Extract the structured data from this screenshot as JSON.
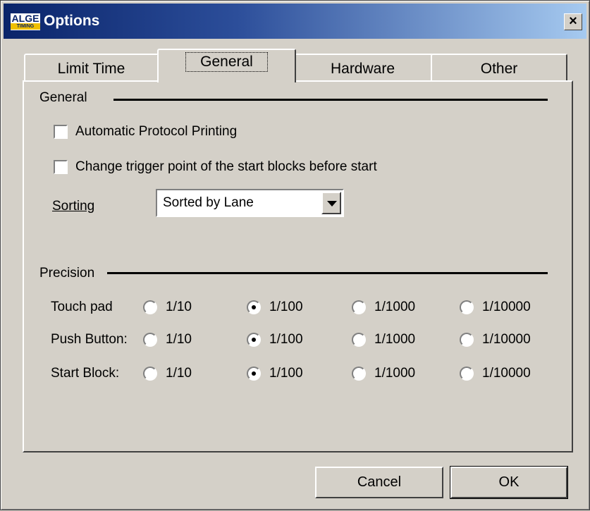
{
  "window": {
    "title": "Options",
    "logo_text": "ALGE",
    "logo_sub": "TIMING",
    "close_label": "×"
  },
  "tabs": [
    {
      "label": "Limit Time",
      "active": false
    },
    {
      "label": "General",
      "active": true
    },
    {
      "label": "Hardware",
      "active": false
    },
    {
      "label": "Other",
      "active": false
    }
  ],
  "general": {
    "section_label": "General",
    "auto_print": {
      "label": "Automatic Protocol Printing",
      "checked": false
    },
    "change_trigger": {
      "label": "Change trigger point of the start blocks before start",
      "checked": false
    },
    "sorting": {
      "label": "Sorting",
      "value": "Sorted by Lane"
    }
  },
  "precision": {
    "section_label": "Precision",
    "options": [
      "1/10",
      "1/100",
      "1/1000",
      "1/10000"
    ],
    "rows": [
      {
        "label": "Touch pad",
        "selected": "1/100"
      },
      {
        "label": "Push Button:",
        "selected": "1/100"
      },
      {
        "label": "Start Block:",
        "selected": "1/100"
      }
    ]
  },
  "buttons": {
    "cancel": "Cancel",
    "ok": "OK"
  }
}
